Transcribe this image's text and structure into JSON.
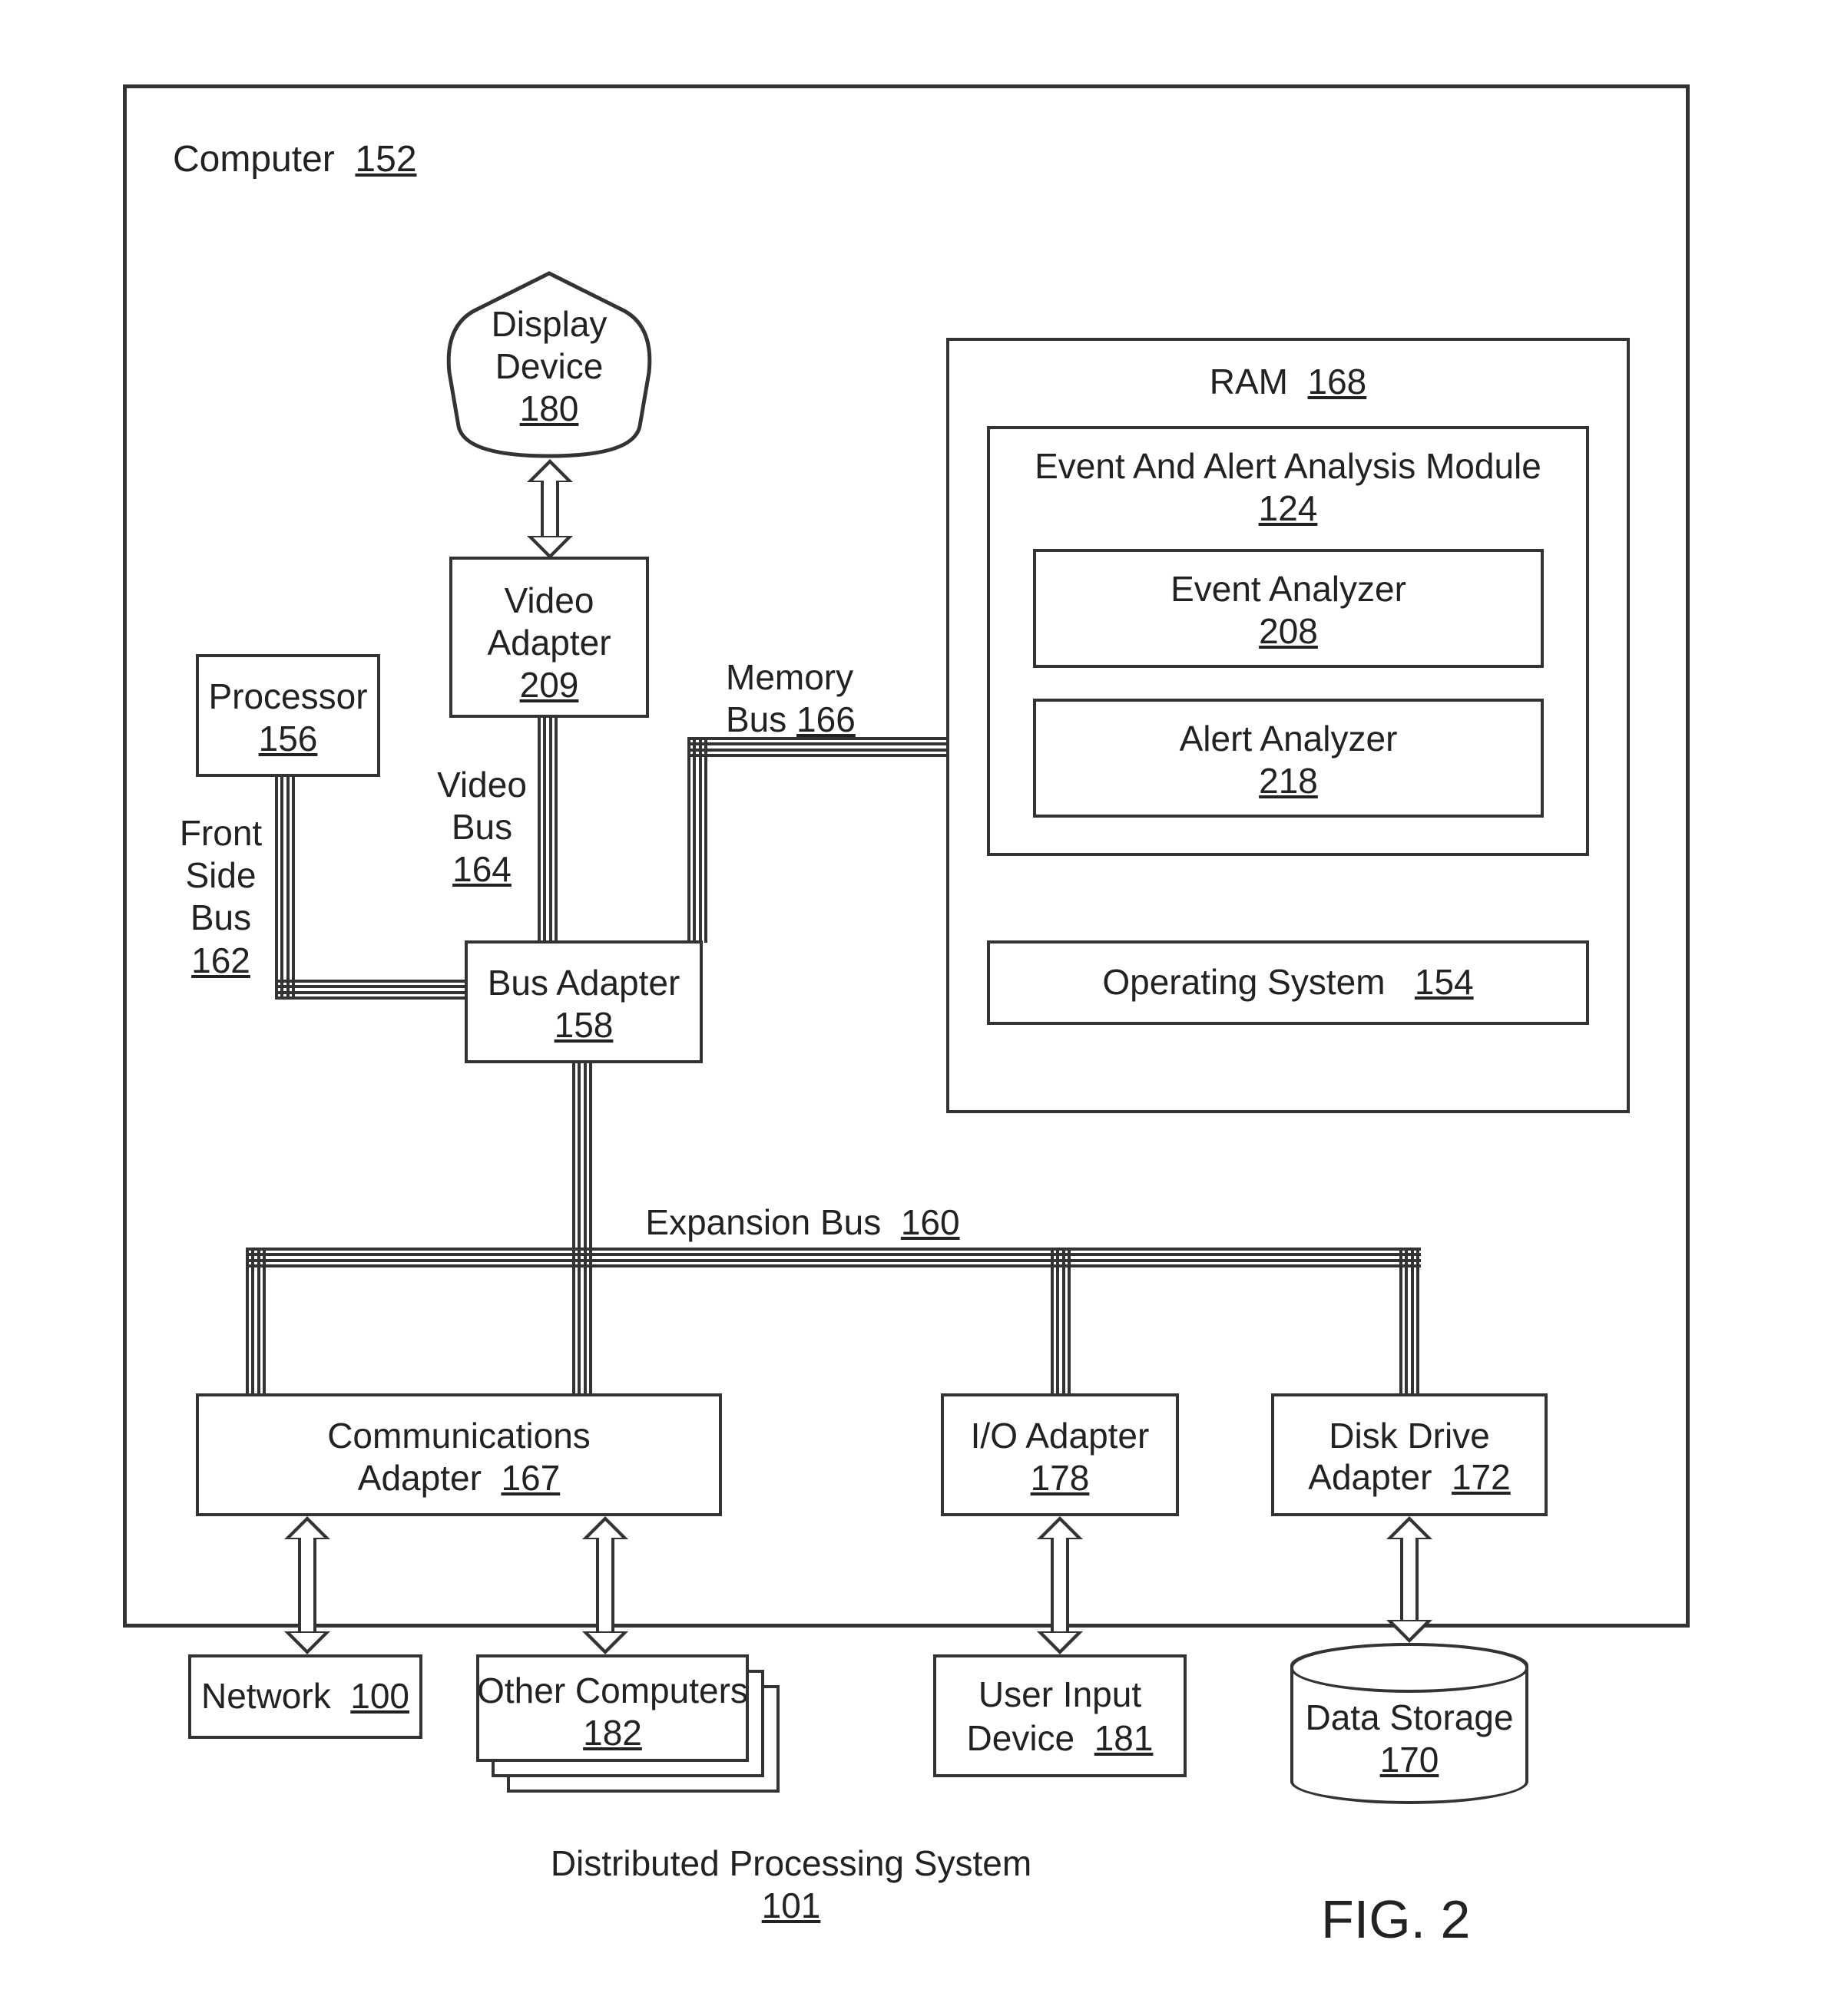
{
  "figure": "FIG. 2",
  "system": {
    "label": "Distributed Processing System",
    "num": "101"
  },
  "computer": {
    "label": "Computer",
    "num": "152"
  },
  "display": {
    "label": "Display Device",
    "num": "180"
  },
  "video_adapter": {
    "label": "Video Adapter",
    "num": "209"
  },
  "processor": {
    "label": "Processor",
    "num": "156"
  },
  "front_side_bus": {
    "label": "Front Side Bus",
    "num": "162"
  },
  "video_bus": {
    "label": "Video Bus",
    "num": "164"
  },
  "memory_bus": {
    "label": "Memory Bus",
    "num": "166"
  },
  "bus_adapter": {
    "label": "Bus Adapter",
    "num": "158"
  },
  "expansion_bus": {
    "label": "Expansion Bus",
    "num": "160"
  },
  "ram": {
    "label": "RAM",
    "num": "168"
  },
  "eam": {
    "label": "Event And Alert Analysis Module",
    "num": "124"
  },
  "event_analyzer": {
    "label": "Event Analyzer",
    "num": "208"
  },
  "alert_analyzer": {
    "label": "Alert Analyzer",
    "num": "218"
  },
  "os": {
    "label": "Operating System",
    "num": "154"
  },
  "comm_adapter": {
    "label": "Communications Adapter",
    "num": "167"
  },
  "io_adapter": {
    "label": "I/O Adapter",
    "num": "178"
  },
  "disk_adapter": {
    "label": "Disk Drive Adapter",
    "num": "172"
  },
  "network": {
    "label": "Network",
    "num": "100"
  },
  "other_computers": {
    "label": "Other Computers",
    "num": "182"
  },
  "user_input": {
    "label": "User Input Device",
    "num": "181"
  },
  "data_storage": {
    "label": "Data Storage",
    "num": "170"
  }
}
